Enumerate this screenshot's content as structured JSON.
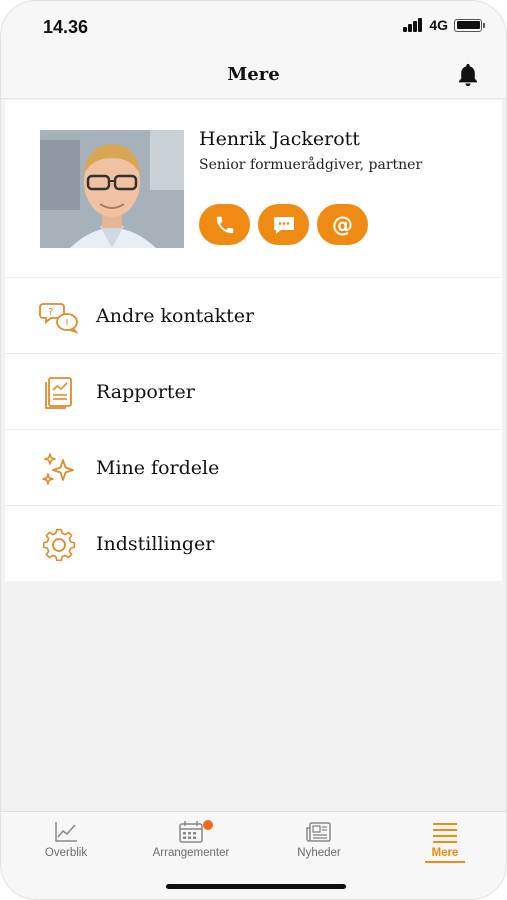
{
  "status": {
    "time": "14.36",
    "network": "4G"
  },
  "header": {
    "title": "Mere"
  },
  "contact": {
    "name": "Henrik Jackerott",
    "role": "Senior formuerådgiver, partner",
    "actions": [
      {
        "icon": "phone-icon",
        "label": "Ring"
      },
      {
        "icon": "message-icon",
        "label": "Besked"
      },
      {
        "icon": "at-icon",
        "text": "@"
      }
    ]
  },
  "menu": {
    "items": [
      {
        "icon": "contacts-icon",
        "label": "Andre kontakter"
      },
      {
        "icon": "reports-icon",
        "label": "Rapporter"
      },
      {
        "icon": "sparkle-icon",
        "label": "Mine fordele"
      },
      {
        "icon": "gear-icon",
        "label": "Indstillinger"
      }
    ]
  },
  "tabbar": {
    "tabs": [
      {
        "icon": "chart-icon",
        "label": "Overblik",
        "active": false
      },
      {
        "icon": "calendar-icon",
        "label": "Arrangementer",
        "active": false,
        "badge": true
      },
      {
        "icon": "newspaper-icon",
        "label": "Nyheder",
        "active": false
      },
      {
        "icon": "menu-icon",
        "label": "Mere",
        "active": true
      }
    ]
  },
  "colors": {
    "accent": "#ef8a13",
    "background": "#f2f2f2",
    "panel": "#ffffff"
  }
}
